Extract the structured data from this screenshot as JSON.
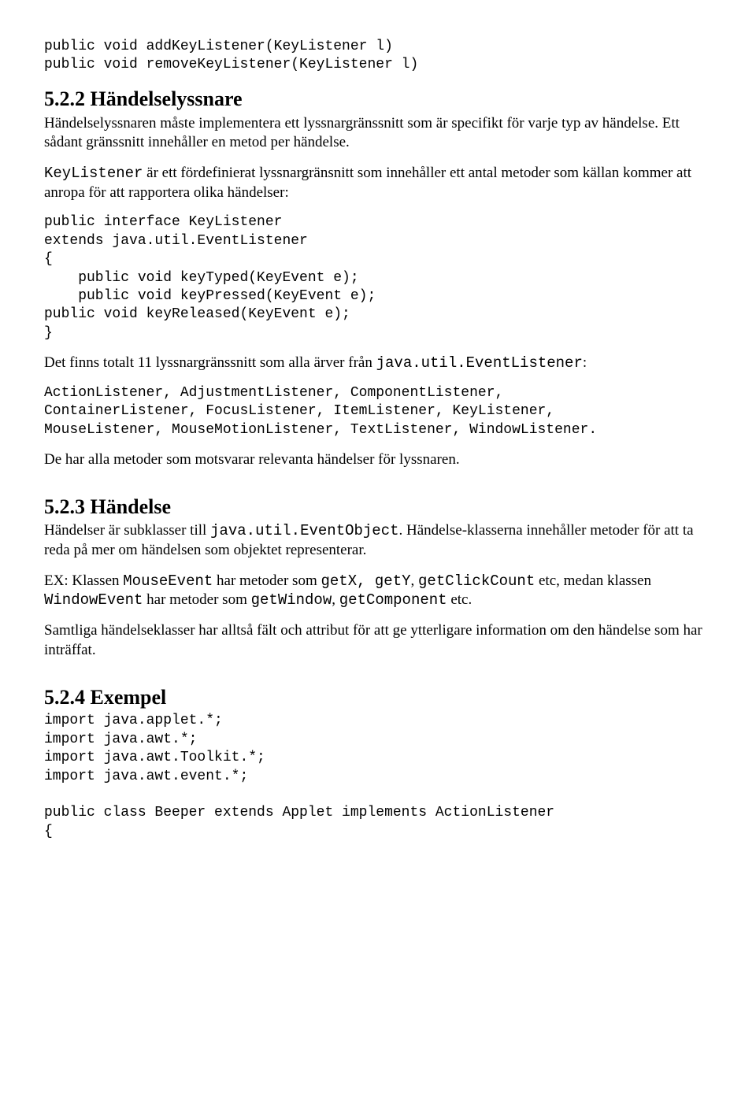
{
  "code_top": "public void addKeyListener(KeyListener l)\npublic void removeKeyListener(KeyListener l)",
  "s522": {
    "heading": "5.2.2 Händelselyssnare",
    "p1": "Händelselyssnaren måste implementera ett lyssnargränssnitt som är specifikt för varje typ av händelse. Ett sådant gränssnitt innehåller en metod per händelse.",
    "p2_pre": "KeyListener",
    "p2_rest": " är ett fördefinierat lyssnargränsnitt som innehåller ett antal metoder som källan kommer att anropa för att rapportera olika händelser:",
    "code": "public interface KeyListener\nextends java.util.EventListener\n{\n    public void keyTyped(KeyEvent e);\n    public void keyPressed(KeyEvent e);\npublic void keyReleased(KeyEvent e);\n}",
    "p3_a": "Det finns totalt 11 lyssnargränssnitt som alla ärver från ",
    "p3_mono": "java.util.EventListener",
    "p3_b": ":",
    "listeners": "ActionListener, AdjustmentListener, ComponentListener,\nContainerListener, FocusListener, ItemListener, KeyListener,\nMouseListener, MouseMotionListener, TextListener, WindowListener.",
    "p4": "De har alla metoder som motsvarar relevanta händelser för lyssnaren."
  },
  "s523": {
    "heading": "5.2.3 Händelse",
    "p1_a": "Händelser är subklasser till ",
    "p1_mono": "java.util.EventObject",
    "p1_b": ". Händelse-klasserna innehåller metoder för att ta reda på mer om händelsen som objektet representerar.",
    "p2_a": "EX: Klassen ",
    "p2_m1": "MouseEvent",
    "p2_b": " har metoder som ",
    "p2_m2": "getX, getY",
    "p2_c": ", ",
    "p2_m3": "getClickCount",
    "p2_d": " etc, medan klassen ",
    "p2_m4": "WindowEvent",
    "p2_e": " har metoder som ",
    "p2_m5": "getWindow",
    "p2_f": ", ",
    "p2_m6": "getComponent",
    "p2_g": " etc.",
    "p3": "Samtliga händelseklasser har alltså fält och attribut för att ge ytterligare information om den händelse som har inträffat."
  },
  "s524": {
    "heading": "5.2.4 Exempel",
    "code": "import java.applet.*;\nimport java.awt.*;\nimport java.awt.Toolkit.*;\nimport java.awt.event.*;\n\npublic class Beeper extends Applet implements ActionListener\n{"
  }
}
